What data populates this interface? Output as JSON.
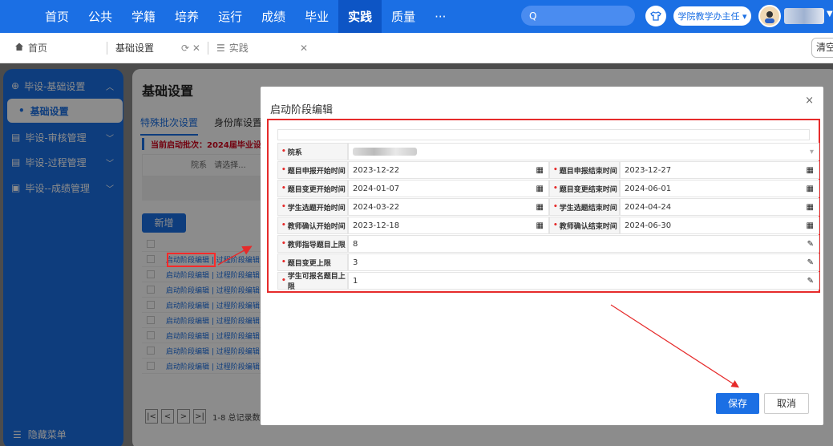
{
  "topnav": {
    "items": [
      {
        "label": "首页"
      },
      {
        "label": "公共"
      },
      {
        "label": "学籍"
      },
      {
        "label": "培养"
      },
      {
        "label": "运行"
      },
      {
        "label": "成绩"
      },
      {
        "label": "毕业"
      },
      {
        "label": "实践",
        "active": true
      },
      {
        "label": "质量"
      },
      {
        "label": "···"
      }
    ],
    "role": "学院教学办主任 ▾",
    "search_icon": "Q"
  },
  "tabs": {
    "home": "首页",
    "basic": "基础设置",
    "practice": "实践",
    "clear": "清空"
  },
  "sidebar": {
    "groups": [
      {
        "label": "毕设-基础设置"
      },
      {
        "label": "基础设置"
      },
      {
        "label": "毕设-审核管理"
      },
      {
        "label": "毕设-过程管理"
      },
      {
        "label": "毕设--成绩管理"
      }
    ],
    "hide_menu": "隐藏菜单"
  },
  "content": {
    "title": "基础设置",
    "tabs": [
      "特殊批次设置",
      "身份库设置"
    ],
    "batch_text": "当前启动批次：2024届毕业设计",
    "filter_label": "院系",
    "filter_placeholder": "请选择...",
    "add_label": "新增",
    "row_link": "启动阶段编辑 | 过程阶段编辑 |",
    "pager_text": "1-8 总记录数"
  },
  "modal": {
    "title": "启动阶段编辑",
    "close": "×",
    "dept_label": "院系",
    "fields": {
      "topic_apply_start_label": "题目申报开始时间",
      "topic_apply_start": "2023-12-22",
      "topic_apply_end_label": "题目申报结束时间",
      "topic_apply_end": "2023-12-27",
      "topic_change_start_label": "题目变更开始时间",
      "topic_change_start": "2024-01-07",
      "topic_change_end_label": "题目变更结束时间",
      "topic_change_end": "2024-06-01",
      "student_select_start_label": "学生选题开始时间",
      "student_select_start": "2024-03-22",
      "student_select_end_label": "学生选题结束时间",
      "student_select_end": "2024-04-24",
      "teacher_confirm_start_label": "教师确认开始时间",
      "teacher_confirm_start": "2023-12-18",
      "teacher_confirm_end_label": "教师确认结束时间",
      "teacher_confirm_end": "2024-06-30",
      "teacher_max_label": "教师指导题目上限",
      "teacher_max": "8",
      "change_max_label": "题目变更上限",
      "change_max": "3",
      "student_max_label": "学生可报名题目上限",
      "student_max": "1"
    },
    "save": "保存",
    "cancel": "取消"
  },
  "colors": {
    "primary": "#1b6fe4",
    "highlight": "#e62b2b"
  }
}
